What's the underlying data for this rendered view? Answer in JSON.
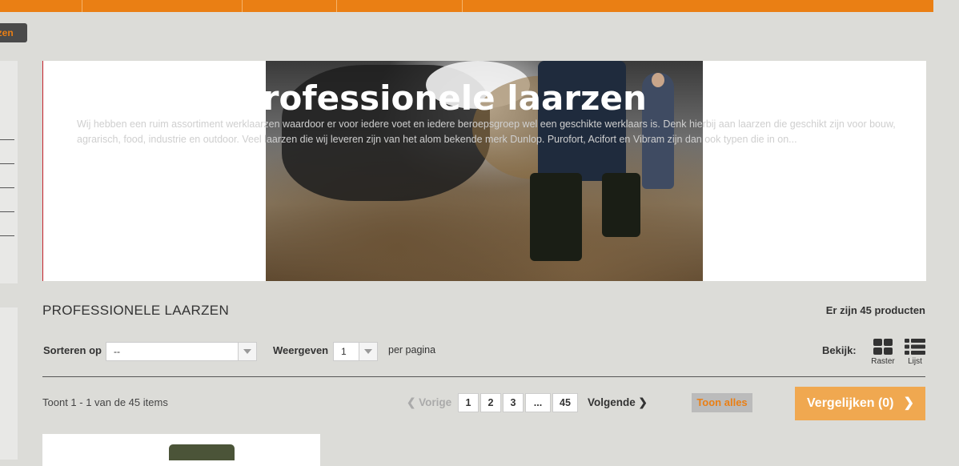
{
  "breadcrumb": {
    "label": "rzen"
  },
  "banner": {
    "title": "Professionele laarzen",
    "description": "Wij hebben een ruim assortiment werklaarzen waardoor er voor iedere voet en iedere beroepsgroep wel een geschikte werklaars is. Denk hierbij aan laarzen die geschikt zijn voor bouw, agrarisch, food, industrie en outdoor. Veel laarzen die wij leveren zijn van het alom bekende merk Dunlop. Purofort, Acifort en Vibram zijn dan ook typen die in on..."
  },
  "category": {
    "title": "PROFESSIONELE LAARZEN",
    "product_count": "Er zijn 45 producten"
  },
  "toolbar": {
    "sort_label": "Sorteren op",
    "sort_value": "--",
    "show_label": "Weergeven",
    "show_value": "1",
    "per_page": "per pagina",
    "view_label": "Bekijk:",
    "grid_label": "Raster",
    "list_label": "Lijst"
  },
  "pagination": {
    "items_text": "Toont 1 - 1 van de 45 items",
    "prev": "Vorige",
    "pages": [
      "1",
      "2",
      "3",
      "...",
      "45"
    ],
    "next": "Volgende",
    "show_all": "Toon alles"
  },
  "compare": {
    "label": "Vergelijken (0)"
  },
  "colors": {
    "accent": "#ea7f14",
    "compare_bg": "#f0a850",
    "background": "#dcdcd8"
  }
}
